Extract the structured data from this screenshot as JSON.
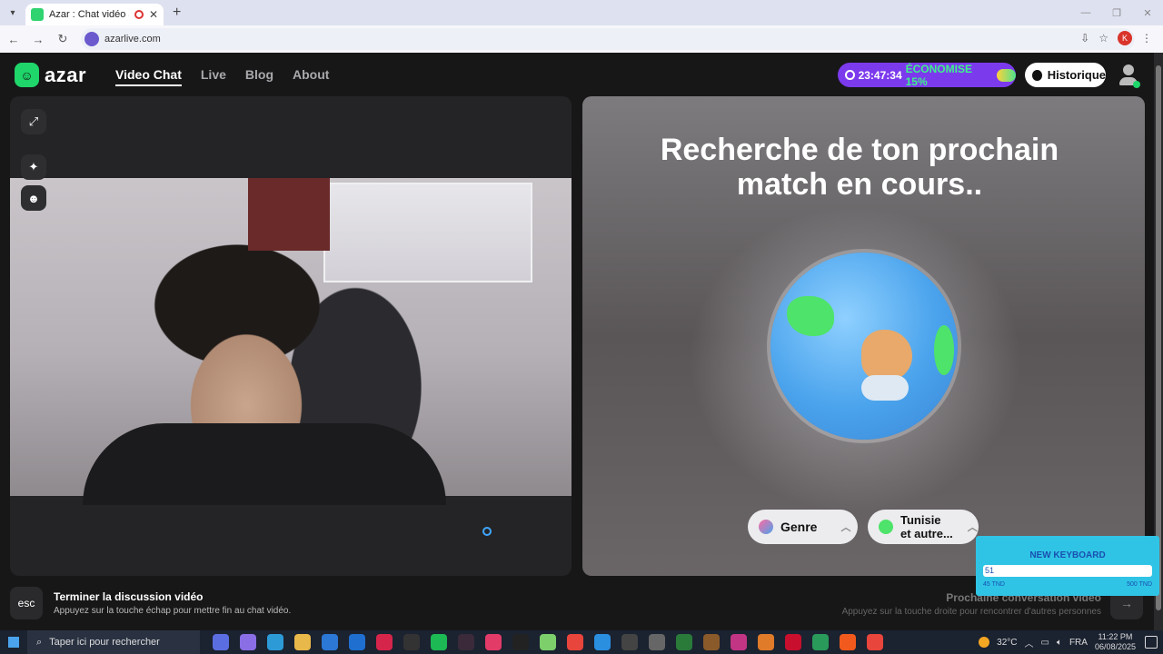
{
  "browser": {
    "tab_title": "Azar : Chat vidéo avec de n",
    "url": "azarlive.com",
    "profile_initial": "K"
  },
  "header": {
    "logo_text": "azar",
    "nav": [
      "Video Chat",
      "Live",
      "Blog",
      "About"
    ],
    "active_nav": "Video Chat",
    "promo_timer": "23:47:34",
    "promo_text": "ÉCONOMISE 15%",
    "history_label": "Historique"
  },
  "right_panel": {
    "headline_line1": "Recherche de ton prochain",
    "headline_line2": "match en cours..",
    "gender_label": "Genre",
    "region_label_line1": "Tunisie",
    "region_label_line2": "et autre..."
  },
  "footer": {
    "esc_key": "esc",
    "end_title": "Terminer la discussion vidéo",
    "end_sub": "Appuyez sur la touche échap pour mettre fin au chat vidéo.",
    "next_title": "Prochaine conversation vidéo",
    "next_sub": "Appuyez sur la touche droite pour rencontrer d'autres personnes"
  },
  "keyboard_widget": {
    "title": "NEW KEYBOARD",
    "value": "51",
    "min_label": "45 TND",
    "max_label": "500 TND"
  },
  "taskbar": {
    "search_placeholder": "Taper ici pour rechercher",
    "temperature": "32°C",
    "language": "FRA",
    "time": "11:22 PM",
    "date": "06/08/2025"
  },
  "colors": {
    "accent_green": "#1fd66a",
    "promo_purple": "#7c3aed",
    "keyboard_cyan": "#2fc4e6"
  }
}
